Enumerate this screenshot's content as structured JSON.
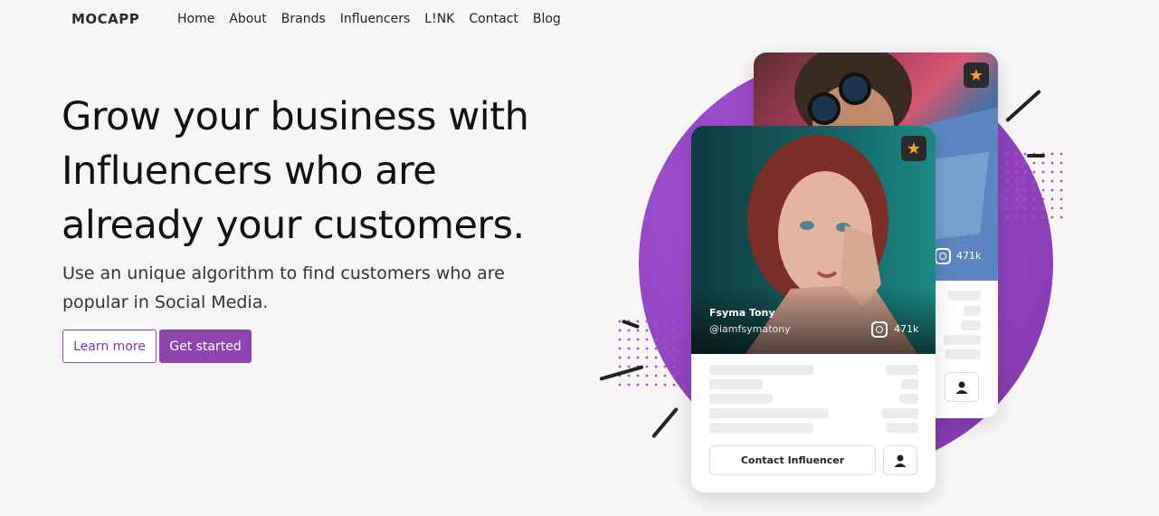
{
  "brand": {
    "logo": "MOCAPP"
  },
  "nav": {
    "items": [
      "Home",
      "About",
      "Brands",
      "Influencers",
      "L!NK",
      "Contact",
      "Blog"
    ]
  },
  "hero": {
    "headline": "Grow your business with Influencers who are already your customers.",
    "subtext": "Use an unique algorithm to find customers who are popular in Social Media.",
    "learn_more": "Learn more",
    "get_started": "Get started"
  },
  "cards": {
    "back": {
      "followers": "471k"
    },
    "front": {
      "name": "Fsyma Tony",
      "handle": "@iamfsymatony",
      "followers": "471k",
      "contact_label": "Contact Influencer"
    }
  },
  "icons": {
    "star": "star-icon",
    "instagram": "instagram-icon",
    "user": "user-icon"
  },
  "colors": {
    "accent": "#8e44ad",
    "star": "#f5a623",
    "circle": "#9b4bc9"
  }
}
